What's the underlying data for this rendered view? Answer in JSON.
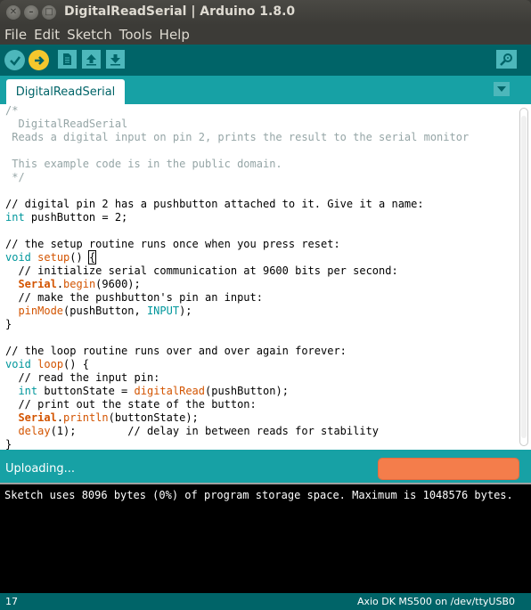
{
  "window": {
    "title": "DigitalReadSerial | Arduino 1.8.0"
  },
  "menu": {
    "items": [
      "File",
      "Edit",
      "Sketch",
      "Tools",
      "Help"
    ]
  },
  "tabs": {
    "active_label": "DigitalReadSerial"
  },
  "editor": {
    "lines": [
      [
        {
          "t": "/*",
          "c": "comment"
        }
      ],
      [
        {
          "t": "  DigitalReadSerial",
          "c": "comment"
        }
      ],
      [
        {
          "t": " Reads a digital input on pin 2, prints the result to the serial monitor",
          "c": "comment"
        }
      ],
      [
        {
          "t": "",
          "c": "plain"
        }
      ],
      [
        {
          "t": " This example code is in the public domain.",
          "c": "comment"
        }
      ],
      [
        {
          "t": " */",
          "c": "comment"
        }
      ],
      [
        {
          "t": "",
          "c": "plain"
        }
      ],
      [
        {
          "t": "// digital pin 2 has a pushbutton attached to it. Give it a name:",
          "c": "plain"
        }
      ],
      [
        {
          "t": "int",
          "c": "keyword"
        },
        {
          "t": " pushButton = 2;",
          "c": "plain"
        }
      ],
      [
        {
          "t": "",
          "c": "plain"
        }
      ],
      [
        {
          "t": "// the setup routine runs once when you press reset:",
          "c": "plain"
        }
      ],
      [
        {
          "t": "void",
          "c": "keyword"
        },
        {
          "t": " ",
          "c": "plain"
        },
        {
          "t": "setup",
          "c": "func"
        },
        {
          "t": "() ",
          "c": "plain"
        },
        {
          "t": "{",
          "c": "brace"
        }
      ],
      [
        {
          "t": "  // initialize serial communication at 9600 bits per second:",
          "c": "plain"
        }
      ],
      [
        {
          "t": "  ",
          "c": "plain"
        },
        {
          "t": "Serial",
          "c": "serial"
        },
        {
          "t": ".",
          "c": "plain"
        },
        {
          "t": "begin",
          "c": "func"
        },
        {
          "t": "(9600);",
          "c": "plain"
        }
      ],
      [
        {
          "t": "  // make the pushbutton's pin an input:",
          "c": "plain"
        }
      ],
      [
        {
          "t": "  ",
          "c": "plain"
        },
        {
          "t": "pinMode",
          "c": "func"
        },
        {
          "t": "(pushButton, ",
          "c": "plain"
        },
        {
          "t": "INPUT",
          "c": "keyword"
        },
        {
          "t": ");",
          "c": "plain"
        }
      ],
      [
        {
          "t": "}",
          "c": "plain"
        }
      ],
      [
        {
          "t": "",
          "c": "plain"
        }
      ],
      [
        {
          "t": "// the loop routine runs over and over again forever:",
          "c": "plain"
        }
      ],
      [
        {
          "t": "void",
          "c": "keyword"
        },
        {
          "t": " ",
          "c": "plain"
        },
        {
          "t": "loop",
          "c": "func"
        },
        {
          "t": "() {",
          "c": "plain"
        }
      ],
      [
        {
          "t": "  // read the input pin:",
          "c": "plain"
        }
      ],
      [
        {
          "t": "  ",
          "c": "plain"
        },
        {
          "t": "int",
          "c": "keyword"
        },
        {
          "t": " buttonState = ",
          "c": "plain"
        },
        {
          "t": "digitalRead",
          "c": "func"
        },
        {
          "t": "(pushButton);",
          "c": "plain"
        }
      ],
      [
        {
          "t": "  // print out the state of the button:",
          "c": "plain"
        }
      ],
      [
        {
          "t": "  ",
          "c": "plain"
        },
        {
          "t": "Serial",
          "c": "serial"
        },
        {
          "t": ".",
          "c": "plain"
        },
        {
          "t": "println",
          "c": "func"
        },
        {
          "t": "(buttonState);",
          "c": "plain"
        }
      ],
      [
        {
          "t": "  ",
          "c": "plain"
        },
        {
          "t": "delay",
          "c": "func"
        },
        {
          "t": "(1);        // delay in between reads for stability",
          "c": "plain"
        }
      ],
      [
        {
          "t": "}",
          "c": "plain"
        }
      ]
    ]
  },
  "status": {
    "message": "Uploading...",
    "progress_percent": 100
  },
  "console": {
    "output": "Sketch uses 8096 bytes (0%) of program storage space. Maximum is 1048576 bytes."
  },
  "footer": {
    "line_number": "17",
    "board": "Axio DK MS500 on /dev/ttyUSB0"
  },
  "colors": {
    "toolbar": "#006468",
    "tabbar": "#17a1a5",
    "comment": "#95a5a6",
    "keyword": "#00979c",
    "function": "#d35400",
    "progress": "#f47d4b"
  }
}
